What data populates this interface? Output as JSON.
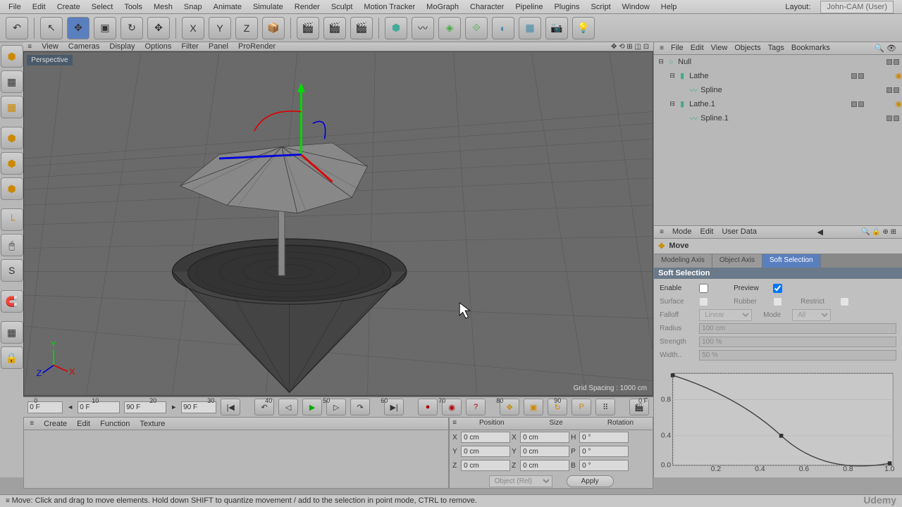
{
  "menus": [
    "File",
    "Edit",
    "Create",
    "Select",
    "Tools",
    "Mesh",
    "Snap",
    "Animate",
    "Simulate",
    "Render",
    "Sculpt",
    "Motion Tracker",
    "MoGraph",
    "Character",
    "Pipeline",
    "Plugins",
    "Script",
    "Window",
    "Help"
  ],
  "layout": {
    "label": "Layout:",
    "value": "John-CAM (User)"
  },
  "view_menu": [
    "View",
    "Cameras",
    "Display",
    "Options",
    "Filter",
    "Panel",
    "ProRender"
  ],
  "viewport": {
    "label": "Perspective",
    "grid": "Grid Spacing : 1000 cm"
  },
  "timeline": {
    "ticks": [
      0,
      10,
      20,
      30,
      40,
      50,
      60,
      70,
      80,
      90
    ],
    "start": "0 F",
    "end": "90 F",
    "cur_start": "0 F",
    "cur_end": "90 F"
  },
  "mat_menu": [
    "Create",
    "Edit",
    "Function",
    "Texture"
  ],
  "coord": {
    "headers": [
      "Position",
      "Size",
      "Rotation"
    ],
    "rows": [
      {
        "axis": "X",
        "pos": "0 cm",
        "size": "0 cm",
        "rotlbl": "H",
        "rot": "0 °"
      },
      {
        "axis": "Y",
        "pos": "0 cm",
        "size": "0 cm",
        "rotlbl": "P",
        "rot": "0 °"
      },
      {
        "axis": "Z",
        "pos": "0 cm",
        "size": "0 cm",
        "rotlbl": "B",
        "rot": "0 °"
      }
    ],
    "mode": "Object (Rel)",
    "apply": "Apply"
  },
  "obj_menu": [
    "File",
    "Edit",
    "View",
    "Objects",
    "Tags",
    "Bookmarks"
  ],
  "objects": [
    {
      "indent": 0,
      "exp": "⊟",
      "icon": "○",
      "name": "Null"
    },
    {
      "indent": 1,
      "exp": "⊟",
      "icon": "▮",
      "name": "Lathe",
      "tag": true
    },
    {
      "indent": 2,
      "exp": "",
      "icon": "〰",
      "name": "Spline"
    },
    {
      "indent": 1,
      "exp": "⊟",
      "icon": "▮",
      "name": "Lathe.1",
      "tag": true
    },
    {
      "indent": 2,
      "exp": "",
      "icon": "〰",
      "name": "Spline.1"
    }
  ],
  "attr_menu": [
    "Mode",
    "Edit",
    "User Data"
  ],
  "move": {
    "icon": "✥",
    "label": "Move"
  },
  "tabs": [
    "Modeling Axis",
    "Object Axis",
    "Soft Selection"
  ],
  "section": "Soft Selection",
  "soft": {
    "enable": "Enable",
    "preview": "Preview",
    "surface": "Surface",
    "rubber": "Rubber",
    "restrict": "Restrict",
    "falloff": "Falloff",
    "falloff_val": "Linear",
    "mode": "Mode",
    "mode_val": "All",
    "radius": "Radius",
    "radius_val": "100 cm",
    "strength": "Strength",
    "strength_val": "100 %",
    "width": "Width..",
    "width_val": "50 %"
  },
  "graph": {
    "yticks": [
      "0.8",
      "0.4",
      "0.0"
    ],
    "xticks": [
      "0.2",
      "0.4",
      "0.6",
      "0.8",
      "1.0"
    ]
  },
  "status": "Move: Click and drag to move elements. Hold down SHIFT to quantize movement / add to the selection in point mode, CTRL to remove.",
  "udemy": "Udemy"
}
